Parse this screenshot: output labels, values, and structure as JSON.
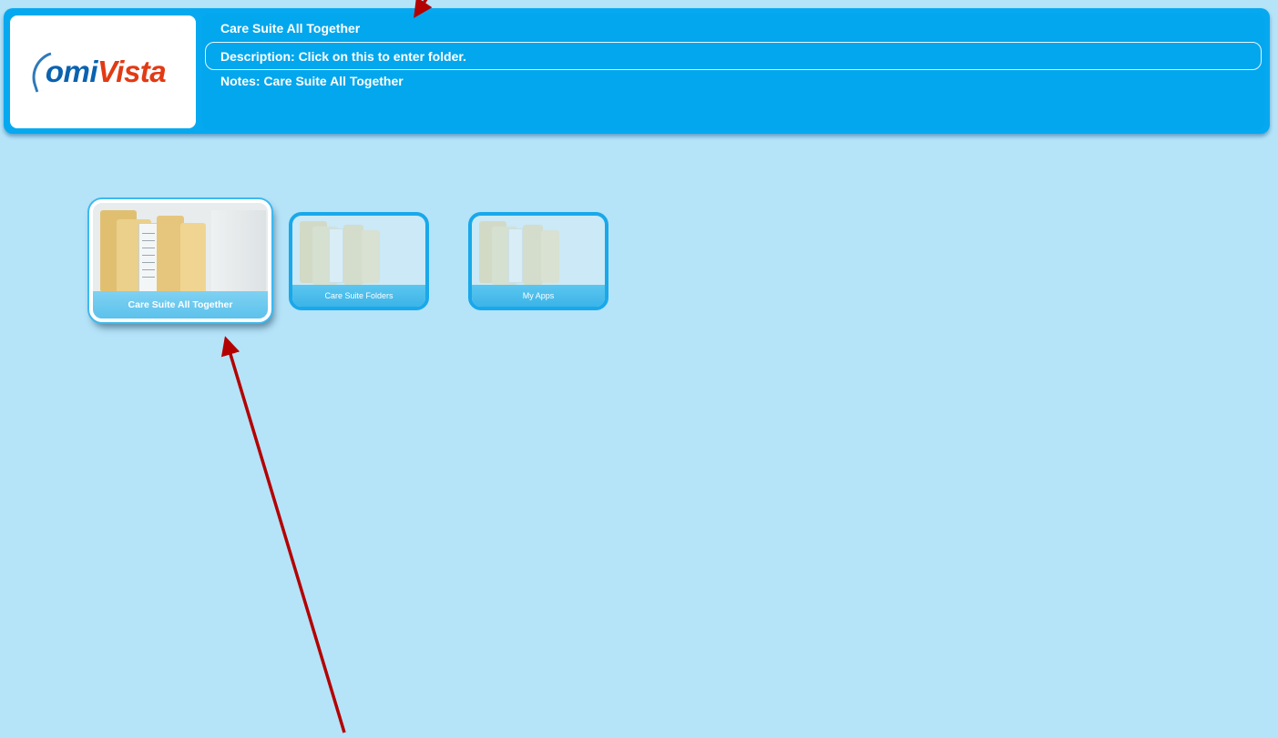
{
  "header": {
    "logo_text_part1": "omi",
    "logo_text_part2": "Vista",
    "title": "Care Suite All Together",
    "description": "Description: Click on this to enter folder.",
    "notes": "Notes: Care Suite All Together"
  },
  "tiles": [
    {
      "label": "Care Suite All Together",
      "selected": true
    },
    {
      "label": "Care Suite Folders",
      "selected": false
    },
    {
      "label": "My Apps",
      "selected": false
    }
  ],
  "colors": {
    "background": "#b5e3f8",
    "header": "#06a9ef",
    "tile_border": "#19a8ea",
    "annotation_arrow": "#b30000",
    "logo_blue": "#0a62b0",
    "logo_red": "#e23a14"
  }
}
